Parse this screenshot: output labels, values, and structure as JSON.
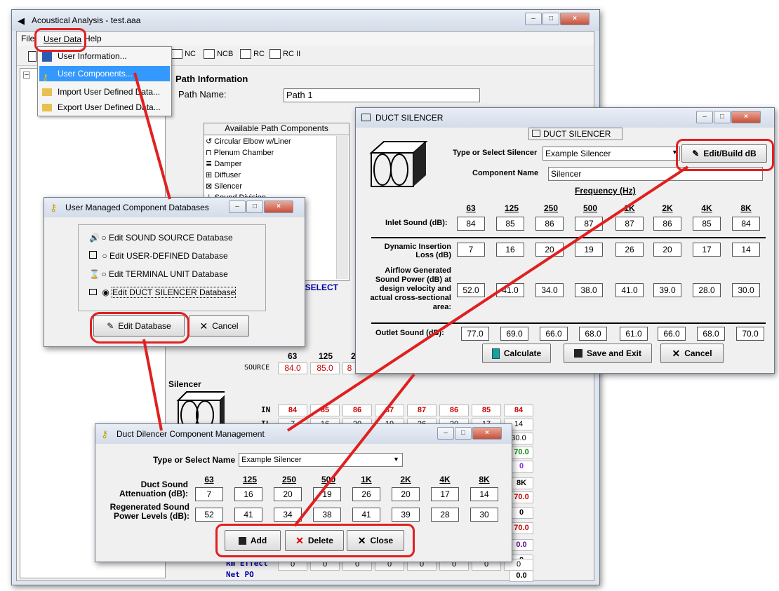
{
  "main": {
    "title": "Acoustical Analysis - test.aaa",
    "menu": [
      "File",
      "User Data",
      "Help"
    ],
    "toolbar_tabs": [
      "NC",
      "NCB",
      "RC",
      "RC II"
    ],
    "path_info_heading": "Path Information",
    "path_name_label": "Path Name:",
    "path_name_value": "Path 1",
    "available_heading": "Available Path Components",
    "components": [
      "Circular Elbow w/Liner",
      "Plenum Chamber",
      "Damper",
      "Diffuser",
      "Silencer",
      "Sound Division"
    ],
    "to_select": "o SELECT",
    "source_label": "SOURCE",
    "source_values": [
      "84.0",
      "85.0",
      "8"
    ],
    "source_bands": [
      "63",
      "125",
      "2"
    ],
    "silencer_label": "Silencer",
    "rows": [
      {
        "label": "IN",
        "values": [
          "84",
          "85",
          "86",
          "87",
          "87",
          "86",
          "85",
          "84"
        ],
        "color": "#cc0000"
      },
      {
        "label": "IL",
        "values": [
          "7",
          "16",
          "20",
          "19",
          "26",
          "20",
          "17",
          "14"
        ],
        "color": "#000000"
      },
      {
        "label": "RG",
        "values": [
          "52.0",
          "41.0",
          "34.0",
          "38.0",
          "41.0",
          "39.0",
          "28.0",
          "30.0"
        ],
        "color": "#000000"
      }
    ],
    "right_col": [
      {
        "v": "70.0",
        "c": "#0a8a0a"
      },
      {
        "v": "0",
        "c": "#8a2be2"
      },
      {
        "v": "8K",
        "c": "#000"
      },
      {
        "v": "70.0",
        "c": "#cc0000"
      },
      {
        "v": "0",
        "c": "#000"
      },
      {
        "v": "70.0",
        "c": "#cc0000"
      },
      {
        "v": "0.0",
        "c": "#5a0a8a"
      },
      {
        "v": "0",
        "c": "#000"
      },
      {
        "v": "0.0",
        "c": "#000"
      }
    ],
    "rm_effect_label": "Rm Effect",
    "rm_effect_values": [
      "0",
      "0",
      "0",
      "0",
      "0",
      "0",
      "0",
      "0"
    ],
    "net_pq_label": "Net PQ"
  },
  "user_data_menu": {
    "items": [
      "User Information...",
      "User Components...",
      "Import User Defined Data...",
      "Export User Defined Data..."
    ]
  },
  "ucd": {
    "title": "User Managed Component Databases",
    "options": [
      "Edit SOUND SOURCE Database",
      "Edit USER-DEFINED Database",
      "Edit TERMINAL UNIT Database",
      "Edit DUCT SILENCER Database"
    ],
    "selected": 3,
    "edit_button": "Edit Database",
    "cancel_button": "Cancel"
  },
  "ds": {
    "title": "DUCT SILENCER",
    "inner_title": "DUCT SILENCER",
    "type_label": "Type or Select Silencer",
    "type_value": "Example Silencer",
    "edit_build_button": "Edit/Build dB",
    "name_label": "Component Name",
    "name_value": "Silencer",
    "freq_heading": "Frequency (Hz)",
    "bands": [
      "63",
      "125",
      "250",
      "500",
      "1K",
      "2K",
      "4K",
      "8K"
    ],
    "inlet_label": "Inlet Sound (dB):",
    "inlet": [
      "84",
      "85",
      "86",
      "87",
      "87",
      "86",
      "85",
      "84"
    ],
    "dil_label": "Dynamic Insertion Loss (dB)",
    "dil": [
      "7",
      "16",
      "20",
      "19",
      "26",
      "20",
      "17",
      "14"
    ],
    "agsp_label": "Airflow Generated Sound Power (dB) at design velocity and actual cross-sectional area:",
    "agsp": [
      "52.0",
      "41.0",
      "34.0",
      "38.0",
      "41.0",
      "39.0",
      "28.0",
      "30.0"
    ],
    "outlet_label": "Outlet Sound (dB):",
    "outlet": [
      "77.0",
      "69.0",
      "66.0",
      "68.0",
      "61.0",
      "66.0",
      "68.0",
      "70.0"
    ],
    "calculate_button": "Calculate",
    "save_button": "Save and Exit",
    "cancel_button": "Cancel"
  },
  "dd": {
    "title": "Duct Dilencer Component Management",
    "type_label": "Type or Select Name",
    "type_value": "Example Silencer",
    "bands": [
      "63",
      "125",
      "250",
      "500",
      "1K",
      "2K",
      "4K",
      "8K"
    ],
    "att_label": "Duct Sound Attenuation (dB):",
    "att": [
      "7",
      "16",
      "20",
      "19",
      "26",
      "20",
      "17",
      "14"
    ],
    "regen_label": "Regenerated Sound Power Levels (dB):",
    "regen": [
      "52",
      "41",
      "34",
      "38",
      "41",
      "39",
      "28",
      "30"
    ],
    "add_button": "Add",
    "delete_button": "Delete",
    "close_button": "Close"
  }
}
